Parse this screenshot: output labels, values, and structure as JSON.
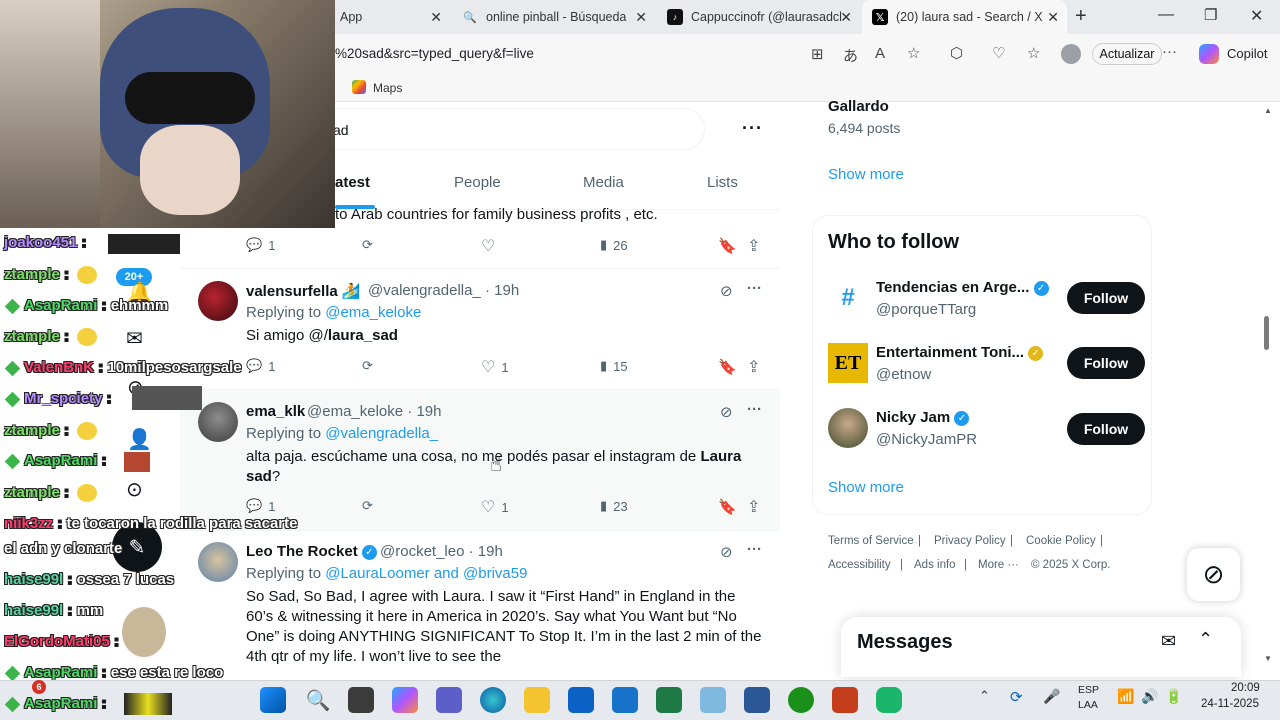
{
  "browser": {
    "tabs": [
      {
        "title": "App",
        "favicon": "app"
      },
      {
        "title": "online pinball - Búsqueda",
        "favicon": "search"
      },
      {
        "title": "Cappuccinofr (@laurasadcl",
        "favicon": "tiktok"
      },
      {
        "title": "(20) laura sad - Search / X",
        "favicon": "x",
        "active": true
      }
    ],
    "url": "%20sad&src=typed_query&f=live",
    "update_label": "Actualizar",
    "copilot_label": "Copilot",
    "bookmark": "Maps"
  },
  "search": {
    "query": "ad",
    "tabs": [
      "atest",
      "People",
      "Media",
      "Lists"
    ]
  },
  "tweets": [
    {
      "text": "to Arab countries for family business profits , etc.",
      "replies": "1",
      "likes": "",
      "views": "26"
    },
    {
      "name": "valensurfella 🏄",
      "handle": "@valengradella_ · 19h",
      "replying_prefix": "Replying to ",
      "replying_to": "@ema_keloke",
      "text_pre": "Si amigo @/",
      "text_bold": "laura_sad",
      "replies": "1",
      "likes": "1",
      "views": "15"
    },
    {
      "name": "ema_klk",
      "handle": "@ema_keloke · 19h",
      "replying_prefix": "Replying to ",
      "replying_to": "@valengradella_",
      "text_pre": "alta paja. escúchame una cosa, no me podés pasar el instagram de ",
      "text_bold": "Laura",
      "text_line2_bold": "sad",
      "text_line2_rest": "?",
      "replies": "1",
      "likes": "1",
      "views": "23"
    },
    {
      "name": "Leo The Rocket",
      "handle": "@rocket_leo · 19h",
      "replying_prefix": "Replying to ",
      "replying_to": "@LauraLoomer and @briva59",
      "text": "So Sad, So Bad, I agree with Laura. I saw it “First Hand” in England in the 60’s & witnessing it here in America in 2020’s.  Say what You Want but “No One” is doing ANYTHING SIGNIFICANT To Stop It.  I’m in the last 2 min of the 4th qtr of my life.  I won’t live to see the"
    }
  ],
  "sidebar": {
    "trend_name": "Gallardo",
    "trend_posts": "6,494 posts",
    "show_more": "Show more",
    "who_to_follow": "Who to follow",
    "follow_label": "Follow",
    "accounts": [
      {
        "name": "Tendencias en Arge...",
        "handle": "@porqueTTarg"
      },
      {
        "name": "Entertainment Toni...",
        "handle": "@etnow"
      },
      {
        "name": "Nicky Jam",
        "handle": "@NickyJamPR"
      }
    ],
    "footer": [
      "Terms of Service",
      "Privacy Policy",
      "Cookie Policy",
      "Accessibility",
      "Ads info",
      "More ···",
      "© 2025 X Corp."
    ],
    "messages": "Messages"
  },
  "notification_badge": "20+",
  "chat": [
    {
      "user": "joakoo451",
      "color": "#b48cff",
      "msg": ""
    },
    {
      "user": "ztample",
      "color": "#7ee06b",
      "msg": ""
    },
    {
      "user": "AsapRami",
      "color": "#4cd964",
      "msg": "ehmmm"
    },
    {
      "user": "ztample",
      "color": "#7ee06b",
      "msg": ""
    },
    {
      "user": "ValenBnK",
      "color": "#ff3b6b",
      "msg": "10milpesosargsale"
    },
    {
      "user": "Mr_spciety",
      "color": "#b48cff",
      "msg": ""
    },
    {
      "user": "ztample",
      "color": "#7ee06b",
      "msg": ""
    },
    {
      "user": "AsapRami",
      "color": "#4cd964",
      "msg": ""
    },
    {
      "user": "ztample",
      "color": "#7ee06b",
      "msg": ""
    },
    {
      "user": "niik3zz",
      "color": "#ff3b6b",
      "msg": "te tocaron la rodilla para sacarte"
    },
    {
      "user": "",
      "color": "#fff",
      "msg": "el adn y clonarte"
    },
    {
      "user": "haise99l",
      "color": "#5ad1a0",
      "msg": "ossea 7 lucas"
    },
    {
      "user": "haise99l",
      "color": "#5ad1a0",
      "msg": "mm"
    },
    {
      "user": "ElGordoMati05",
      "color": "#ff3b6b",
      "msg": ""
    },
    {
      "user": "AsapRami",
      "color": "#4cd964",
      "msg": "ese esta re loco"
    },
    {
      "user": "AsapRami",
      "color": "#4cd964",
      "msg": ""
    }
  ],
  "taskbar": {
    "lang1": "ESP",
    "lang2": "LAA",
    "time": "20:09",
    "date": "24-11-2025",
    "badge": "6"
  }
}
